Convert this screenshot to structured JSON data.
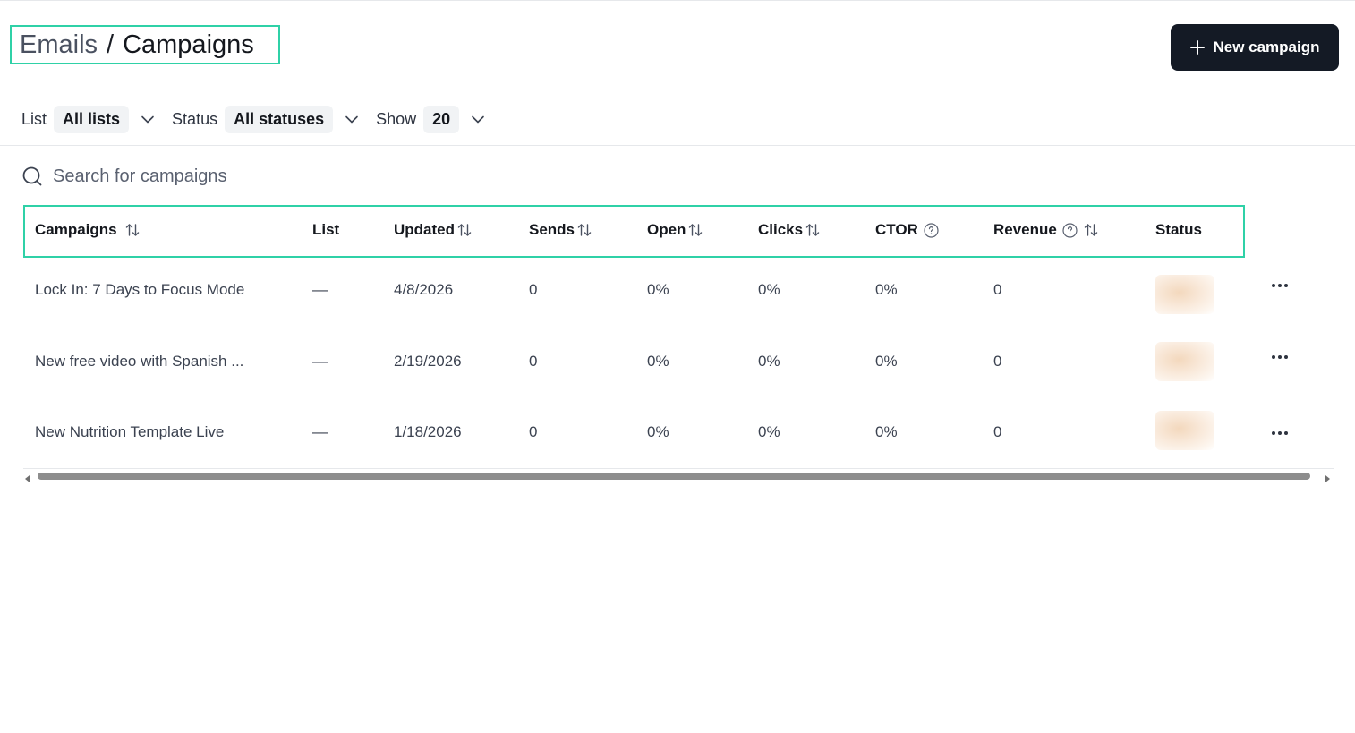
{
  "header": {
    "breadcrumb_parent": "Emails",
    "breadcrumb_separator": "/",
    "breadcrumb_current": "Campaigns",
    "new_campaign_label": "New campaign"
  },
  "filters": {
    "list_label": "List",
    "list_value": "All lists",
    "status_label": "Status",
    "status_value": "All statuses",
    "show_label": "Show",
    "show_value": "20"
  },
  "search": {
    "placeholder": "Search for campaigns"
  },
  "table": {
    "columns": [
      {
        "label": "Campaigns",
        "sortable": true,
        "help": false
      },
      {
        "label": "List",
        "sortable": false,
        "help": false
      },
      {
        "label": "Updated",
        "sortable": true,
        "help": false
      },
      {
        "label": "Sends",
        "sortable": true,
        "help": false
      },
      {
        "label": "Open",
        "sortable": true,
        "help": false
      },
      {
        "label": "Clicks",
        "sortable": true,
        "help": false
      },
      {
        "label": "CTOR",
        "sortable": false,
        "help": true
      },
      {
        "label": "Revenue",
        "sortable": true,
        "help": true
      },
      {
        "label": "Status",
        "sortable": false,
        "help": false
      }
    ],
    "rows": [
      {
        "campaign": "Lock In: 7 Days to Focus Mode",
        "list": "—",
        "updated": "4/8/2026",
        "sends": "0",
        "open": "0%",
        "clicks": "0%",
        "ctor": "0%",
        "revenue": "0"
      },
      {
        "campaign": "New free video with Spanish ...",
        "list": "—",
        "updated": "2/19/2026",
        "sends": "0",
        "open": "0%",
        "clicks": "0%",
        "ctor": "0%",
        "revenue": "0"
      },
      {
        "campaign": "New Nutrition Template Live",
        "list": "—",
        "updated": "1/18/2026",
        "sends": "0",
        "open": "0%",
        "clicks": "0%",
        "ctor": "0%",
        "revenue": "0"
      }
    ]
  },
  "icons": {
    "plus": "plus-icon",
    "chevron": "chevron-down-icon",
    "search": "search-icon",
    "sort": "sort-icon",
    "help": "help-icon",
    "more": "more-horizontal-icon"
  },
  "colors": {
    "accent_outline": "#2fd1a7",
    "primary_button": "#141a25",
    "scroll_thumb": "#8d8d8d"
  }
}
